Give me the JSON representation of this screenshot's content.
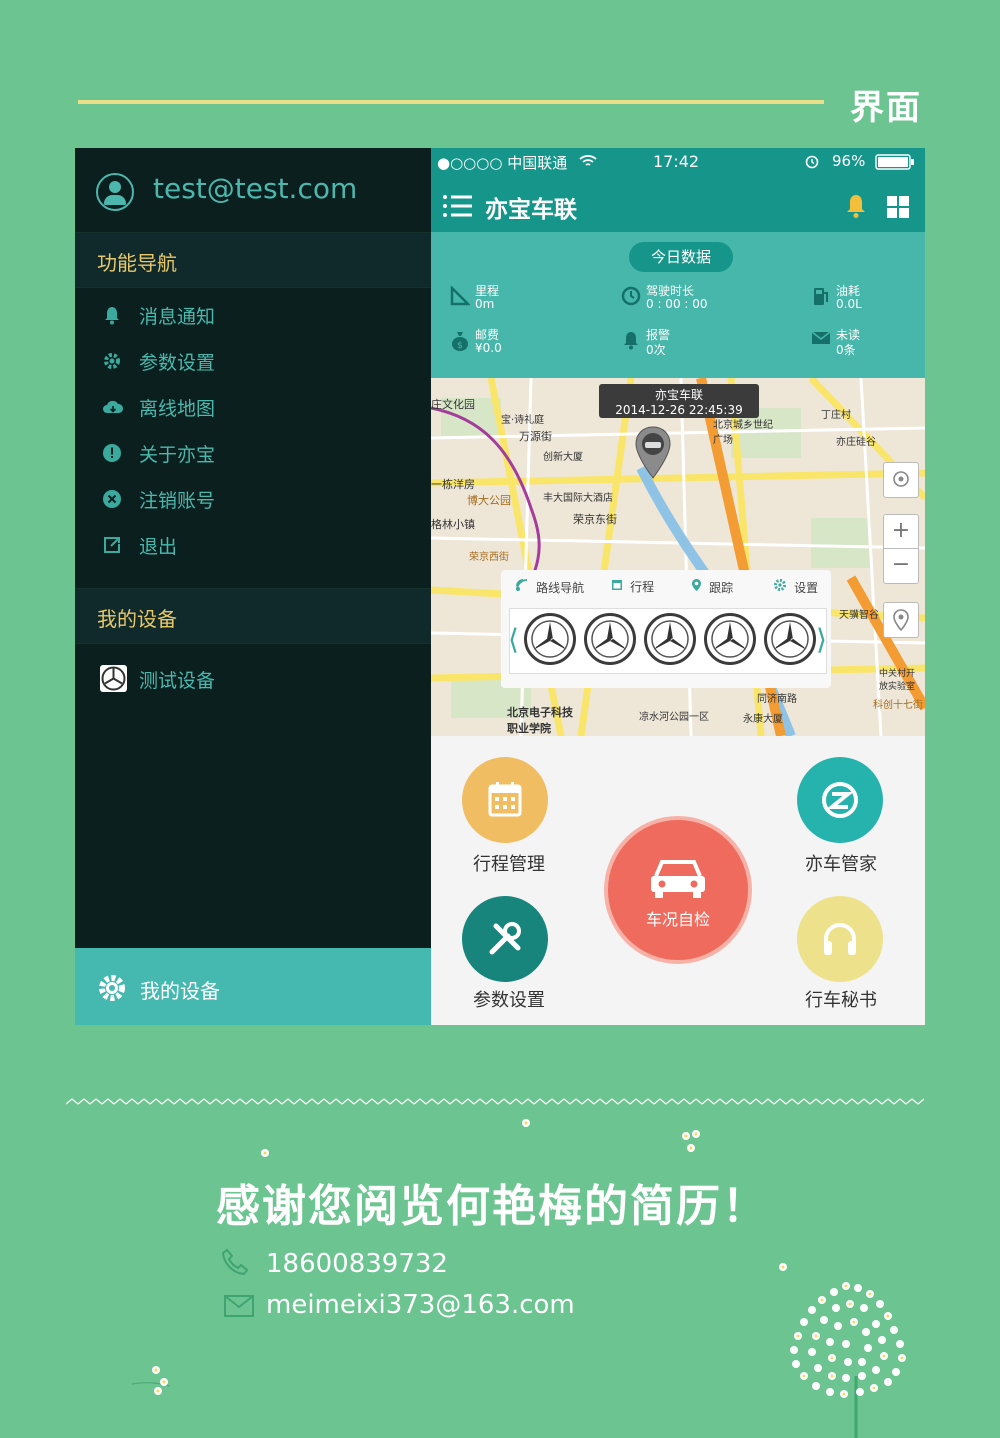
{
  "header": {
    "title": "界面"
  },
  "drawer": {
    "email": "test@test.com",
    "nav_section": "功能导航",
    "nav_items": [
      {
        "label": "消息通知",
        "icon": "bell-icon"
      },
      {
        "label": "参数设置",
        "icon": "gear-icon"
      },
      {
        "label": "离线地图",
        "icon": "cloud-download-icon"
      },
      {
        "label": "关于亦宝",
        "icon": "info-icon"
      },
      {
        "label": "注销账号",
        "icon": "close-circle-icon"
      },
      {
        "label": "退出",
        "icon": "exit-icon"
      }
    ],
    "device_section": "我的设备",
    "devices": [
      "测试设备"
    ],
    "bottom_label": "我的设备"
  },
  "phone": {
    "status": {
      "carrier": "●○○○○ 中国联通",
      "time": "17:42",
      "battery": "96%"
    },
    "app_title": "亦宝车联",
    "today_button": "今日数据",
    "stats": [
      {
        "label": "里程",
        "value": "0m",
        "icon": "ruler-icon"
      },
      {
        "label": "驾驶时长",
        "value": "0 : 00 : 00",
        "icon": "clock-icon"
      },
      {
        "label": "油耗",
        "value": "0.0L",
        "icon": "fuel-icon"
      },
      {
        "label": "邮费",
        "value": "¥0.0",
        "icon": "money-bag-icon"
      },
      {
        "label": "报警",
        "value": "0次",
        "icon": "alarm-icon"
      },
      {
        "label": "未读",
        "value": "0条",
        "icon": "mail-icon"
      }
    ],
    "map": {
      "info_title": "亦宝车联",
      "info_time": "2014-12-26 22:45:39",
      "labels": [
        "庄文化园",
        "宝·诗礼庭",
        "万源街",
        "北京城乡世纪广场",
        "丁庄村",
        "亦庄硅谷",
        "创新大厦",
        "一栋洋房",
        "博大公园",
        "丰大国际大酒店",
        "荣京东街",
        "格林小镇",
        "荣京西街",
        "天骥智谷",
        "中关村开放实验室",
        "北京电子科技职业学院",
        "凉水河公园一区",
        "永康大厦",
        "同济南路",
        "科创十七街"
      ],
      "panel_tabs": [
        "路线导航",
        "行程",
        "跟踪",
        "设置"
      ]
    },
    "features": [
      {
        "label": "行程管理",
        "icon": "calendar-icon",
        "color": "#f0bd62"
      },
      {
        "label": "亦车管家",
        "icon": "swirl-logo-icon",
        "color": "#27b3ad"
      },
      {
        "label": "车况自检",
        "icon": "car-icon",
        "color": "#ee6b5d"
      },
      {
        "label": "参数设置",
        "icon": "wrench-icon",
        "color": "#17857b"
      },
      {
        "label": "行车秘书",
        "icon": "headphones-icon",
        "color": "#ede28b"
      }
    ]
  },
  "footer": {
    "thanks": "感谢您阅览何艳梅的简历！",
    "phone": "18600839732",
    "email": "meimeixi373@163.com"
  },
  "colors": {
    "background": "#6cc591",
    "drawer": "#0b1f1e",
    "teal": "#16968b",
    "accent_gold": "#e7c86a"
  }
}
